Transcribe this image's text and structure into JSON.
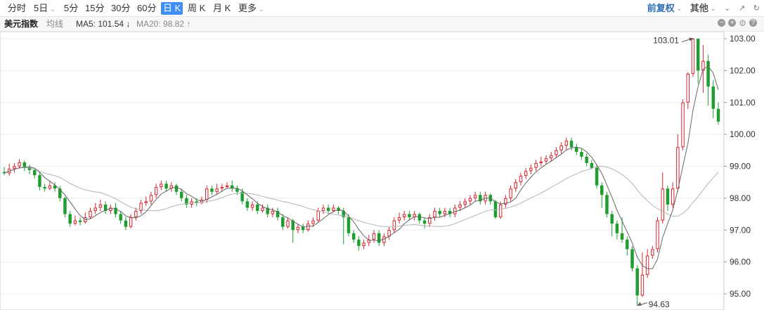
{
  "toolbar": {
    "tabs": [
      {
        "label": "分时",
        "active": false
      },
      {
        "label": "5日",
        "active": false,
        "dropdown": true
      },
      {
        "label": "5分",
        "active": false
      },
      {
        "label": "15分",
        "active": false
      },
      {
        "label": "30分",
        "active": false
      },
      {
        "label": "60分",
        "active": false
      },
      {
        "label": "日 K",
        "active": true
      },
      {
        "label": "周 K",
        "active": false
      },
      {
        "label": "月 K",
        "active": false
      },
      {
        "label": "更多",
        "active": false,
        "dropdown": true
      }
    ],
    "right": {
      "fuquan": "前复权",
      "qita": "其他"
    }
  },
  "info": {
    "name": "美元指数",
    "ma_label": "均线",
    "ma5": "MA5: 101.54 ↓",
    "ma20": "MA20: 98.82 ↑"
  },
  "chart_data": {
    "type": "candlestick",
    "y_ticks": [
      "103.00",
      "102.00",
      "101.00",
      "100.00",
      "99.00",
      "98.00",
      "97.00",
      "96.00",
      "95.00"
    ],
    "ylim": [
      94.7,
      103.2
    ],
    "high_label": "103.01",
    "low_label": "94.63",
    "colors": {
      "up": "#d9252e",
      "down": "#1e9e2f",
      "ma5": "#666666",
      "ma20": "#b4b4b4",
      "grid": "#eeeeee"
    },
    "candles": [
      [
        98.82,
        98.78,
        98.98,
        98.72
      ],
      [
        98.78,
        98.92,
        99.08,
        98.7
      ],
      [
        98.92,
        99.0,
        99.1,
        98.8
      ],
      [
        99.0,
        99.12,
        99.22,
        98.92
      ],
      [
        99.12,
        98.98,
        99.18,
        98.85
      ],
      [
        98.98,
        98.88,
        99.05,
        98.75
      ],
      [
        98.88,
        98.72,
        98.95,
        98.62
      ],
      [
        98.72,
        98.35,
        98.8,
        98.25
      ],
      [
        98.35,
        98.3,
        98.45,
        98.2
      ],
      [
        98.3,
        98.4,
        98.52,
        98.25
      ],
      [
        98.4,
        98.3,
        98.5,
        98.2
      ],
      [
        98.3,
        98.0,
        98.38,
        97.9
      ],
      [
        98.0,
        97.5,
        98.05,
        97.4
      ],
      [
        97.5,
        97.2,
        97.6,
        97.1
      ],
      [
        97.2,
        97.3,
        97.45,
        97.15
      ],
      [
        97.3,
        97.25,
        97.4,
        97.15
      ],
      [
        97.25,
        97.4,
        97.55,
        97.2
      ],
      [
        97.4,
        97.6,
        97.7,
        97.35
      ],
      [
        97.6,
        97.7,
        97.85,
        97.5
      ],
      [
        97.7,
        97.8,
        97.95,
        97.6
      ],
      [
        97.8,
        97.6,
        97.9,
        97.5
      ],
      [
        97.6,
        97.7,
        97.8,
        97.5
      ],
      [
        97.7,
        97.5,
        97.85,
        97.4
      ],
      [
        97.5,
        97.3,
        97.6,
        97.2
      ],
      [
        97.3,
        97.1,
        97.4,
        97.0
      ],
      [
        97.1,
        97.4,
        97.5,
        97.05
      ],
      [
        97.4,
        97.6,
        97.7,
        97.3
      ],
      [
        97.6,
        97.85,
        97.95,
        97.5
      ],
      [
        97.85,
        97.9,
        98.05,
        97.75
      ],
      [
        97.9,
        98.1,
        98.2,
        97.8
      ],
      [
        98.1,
        98.35,
        98.45,
        98.0
      ],
      [
        98.35,
        98.45,
        98.55,
        98.25
      ],
      [
        98.45,
        98.3,
        98.55,
        98.2
      ],
      [
        98.3,
        98.4,
        98.5,
        98.2
      ],
      [
        98.4,
        98.2,
        98.45,
        98.1
      ],
      [
        98.2,
        98.0,
        98.3,
        97.9
      ],
      [
        98.0,
        97.8,
        98.1,
        97.7
      ],
      [
        97.8,
        97.9,
        98.0,
        97.7
      ],
      [
        97.9,
        97.85,
        98.0,
        97.75
      ],
      [
        97.85,
        97.95,
        98.05,
        97.8
      ],
      [
        97.95,
        98.3,
        98.4,
        97.85
      ],
      [
        98.3,
        98.2,
        98.4,
        98.1
      ],
      [
        98.2,
        98.3,
        98.45,
        98.1
      ],
      [
        98.3,
        98.35,
        98.45,
        98.2
      ],
      [
        98.35,
        98.4,
        98.5,
        98.3
      ],
      [
        98.4,
        98.3,
        98.55,
        98.2
      ],
      [
        98.3,
        98.2,
        98.4,
        98.1
      ],
      [
        98.2,
        97.9,
        98.3,
        97.8
      ],
      [
        97.9,
        97.7,
        98.0,
        97.6
      ],
      [
        97.7,
        97.8,
        97.9,
        97.6
      ],
      [
        97.8,
        97.6,
        97.9,
        97.5
      ],
      [
        97.6,
        97.7,
        97.8,
        97.55
      ],
      [
        97.7,
        97.5,
        97.8,
        97.4
      ],
      [
        97.5,
        97.6,
        97.7,
        97.4
      ],
      [
        97.6,
        97.4,
        97.7,
        97.3
      ],
      [
        97.4,
        97.1,
        97.5,
        97.0
      ],
      [
        97.1,
        97.3,
        97.4,
        97.05
      ],
      [
        97.3,
        97.0,
        97.35,
        96.6
      ],
      [
        97.0,
        97.1,
        97.2,
        96.9
      ],
      [
        97.1,
        97.0,
        97.2,
        96.9
      ],
      [
        97.0,
        97.2,
        97.3,
        96.95
      ],
      [
        97.2,
        97.3,
        97.4,
        97.1
      ],
      [
        97.3,
        97.6,
        97.7,
        97.25
      ],
      [
        97.6,
        97.7,
        97.8,
        97.5
      ],
      [
        97.7,
        97.6,
        97.8,
        97.5
      ],
      [
        97.6,
        97.7,
        97.8,
        97.55
      ],
      [
        97.7,
        97.6,
        97.75,
        97.5
      ],
      [
        97.6,
        97.4,
        97.7,
        96.55
      ],
      [
        97.4,
        96.9,
        97.5,
        96.8
      ],
      [
        96.9,
        96.7,
        97.0,
        96.6
      ],
      [
        96.7,
        96.5,
        96.8,
        96.35
      ],
      [
        96.5,
        96.6,
        96.7,
        96.4
      ],
      [
        96.6,
        96.7,
        96.85,
        96.5
      ],
      [
        96.7,
        96.9,
        97.0,
        96.6
      ],
      [
        96.9,
        96.6,
        97.0,
        96.5
      ],
      [
        96.6,
        96.8,
        96.9,
        96.5
      ],
      [
        96.8,
        97.0,
        97.1,
        96.7
      ],
      [
        97.0,
        97.3,
        97.4,
        96.9
      ],
      [
        97.3,
        97.4,
        97.55,
        97.2
      ],
      [
        97.4,
        97.5,
        97.6,
        97.3
      ],
      [
        97.5,
        97.4,
        97.6,
        97.3
      ],
      [
        97.4,
        97.5,
        97.6,
        97.3
      ],
      [
        97.5,
        97.3,
        97.55,
        97.2
      ],
      [
        97.3,
        97.2,
        97.4,
        97.05
      ],
      [
        97.2,
        97.4,
        97.5,
        97.1
      ],
      [
        97.4,
        97.6,
        97.7,
        97.3
      ],
      [
        97.6,
        97.5,
        97.7,
        97.4
      ],
      [
        97.5,
        97.6,
        97.7,
        97.4
      ],
      [
        97.6,
        97.5,
        97.7,
        97.4
      ],
      [
        97.5,
        97.7,
        97.8,
        97.4
      ],
      [
        97.7,
        97.8,
        97.9,
        97.6
      ],
      [
        97.8,
        97.9,
        98.0,
        97.7
      ],
      [
        97.9,
        98.0,
        98.1,
        97.8
      ],
      [
        98.0,
        98.1,
        98.2,
        97.9
      ],
      [
        98.1,
        97.9,
        98.2,
        97.8
      ],
      [
        97.9,
        98.1,
        98.2,
        97.8
      ],
      [
        98.1,
        97.9,
        98.15,
        97.8
      ],
      [
        97.9,
        97.4,
        97.95,
        97.35
      ],
      [
        97.4,
        97.8,
        97.9,
        97.35
      ],
      [
        97.8,
        98.0,
        98.1,
        97.7
      ],
      [
        98.0,
        98.3,
        98.4,
        97.9
      ],
      [
        98.3,
        98.5,
        98.6,
        98.2
      ],
      [
        98.5,
        98.7,
        98.8,
        98.4
      ],
      [
        98.7,
        98.85,
        98.95,
        98.6
      ],
      [
        98.85,
        98.95,
        99.05,
        98.75
      ],
      [
        98.95,
        99.1,
        99.2,
        98.85
      ],
      [
        99.1,
        99.15,
        99.3,
        99.0
      ],
      [
        99.15,
        99.25,
        99.35,
        99.05
      ],
      [
        99.25,
        99.35,
        99.45,
        99.15
      ],
      [
        99.35,
        99.5,
        99.6,
        99.25
      ],
      [
        99.5,
        99.65,
        99.75,
        99.4
      ],
      [
        99.65,
        99.8,
        99.9,
        99.5
      ],
      [
        99.8,
        99.6,
        99.9,
        99.5
      ],
      [
        99.6,
        99.45,
        99.7,
        99.35
      ],
      [
        99.45,
        99.3,
        99.55,
        99.2
      ],
      [
        99.3,
        99.1,
        99.4,
        99.0
      ],
      [
        99.1,
        98.95,
        99.2,
        98.9
      ],
      [
        98.95,
        98.4,
        99.05,
        98.3
      ],
      [
        98.4,
        98.1,
        98.5,
        97.7
      ],
      [
        98.1,
        97.5,
        98.2,
        97.4
      ],
      [
        97.5,
        97.2,
        97.6,
        96.8
      ],
      [
        97.2,
        96.9,
        97.3,
        96.7
      ],
      [
        96.9,
        96.7,
        97.4,
        96.6
      ],
      [
        96.7,
        96.4,
        96.8,
        96.2
      ],
      [
        96.4,
        95.8,
        96.5,
        95.7
      ],
      [
        95.8,
        94.95,
        95.9,
        94.63
      ],
      [
        94.95,
        95.6,
        96.3,
        94.9
      ],
      [
        95.6,
        96.2,
        96.4,
        95.5
      ],
      [
        96.2,
        96.4,
        96.5,
        96.1
      ],
      [
        96.4,
        97.3,
        97.4,
        96.3
      ],
      [
        97.3,
        98.3,
        98.8,
        97.2
      ],
      [
        98.3,
        97.8,
        98.4,
        97.6
      ],
      [
        97.8,
        98.3,
        98.5,
        97.7
      ],
      [
        98.3,
        99.6,
        100.0,
        98.2
      ],
      [
        99.6,
        101.0,
        101.1,
        99.5
      ],
      [
        101.0,
        101.9,
        101.95,
        100.8
      ],
      [
        101.9,
        103.0,
        103.01,
        101.8
      ],
      [
        103.0,
        102.0,
        103.0,
        101.6
      ],
      [
        102.0,
        102.3,
        102.8,
        101.3
      ],
      [
        102.3,
        101.5,
        102.5,
        100.9
      ],
      [
        101.5,
        100.8,
        101.7,
        100.5
      ],
      [
        100.8,
        100.4,
        101.0,
        100.3
      ]
    ]
  }
}
